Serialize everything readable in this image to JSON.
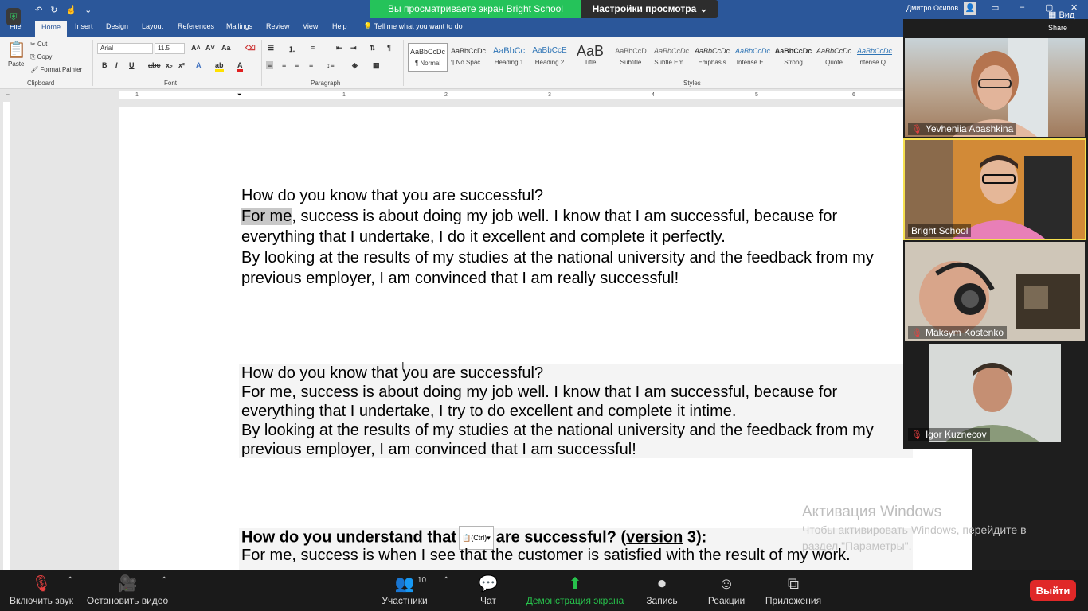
{
  "word": {
    "tabs": [
      "File",
      "Home",
      "Insert",
      "Design",
      "Layout",
      "References",
      "Mailings",
      "Review",
      "View",
      "Help"
    ],
    "tell_me": "Tell me what you want to do",
    "user_name": "Дмитро Осипов",
    "clipboard": {
      "paste": "Paste",
      "cut": "Cut",
      "copy": "Copy",
      "format_painter": "Format Painter",
      "label": "Clipboard"
    },
    "font": {
      "name": "Arial",
      "size": "11.5",
      "label": "Font"
    },
    "paragraph_label": "Paragraph",
    "styles_label": "Styles",
    "styles": [
      {
        "sample": "AaBbCcDc",
        "name": "¶ Normal"
      },
      {
        "sample": "AaBbCcDc",
        "name": "¶ No Spac..."
      },
      {
        "sample": "AaBbCc",
        "name": "Heading 1"
      },
      {
        "sample": "AaBbCcE",
        "name": "Heading 2"
      },
      {
        "sample": "AaB",
        "name": "Title"
      },
      {
        "sample": "AaBbCcD",
        "name": "Subtitle"
      },
      {
        "sample": "AaBbCcDc",
        "name": "Subtle Em..."
      },
      {
        "sample": "AaBbCcDc",
        "name": "Emphasis"
      },
      {
        "sample": "AaBbCcDc",
        "name": "Intense E..."
      },
      {
        "sample": "AaBbCcDc",
        "name": "Strong"
      },
      {
        "sample": "AaBbCcDc",
        "name": "Quote"
      },
      {
        "sample": "AaBbCcDc",
        "name": "Intense Q..."
      }
    ],
    "ruler_numbers": [
      "1",
      "1",
      "2",
      "3",
      "4",
      "5",
      "6"
    ]
  },
  "zoom": {
    "banner": "Вы просматриваете экран Bright School",
    "view_options": "Настройки просмотра",
    "view_label": "Вид",
    "share_label": "Share",
    "participants": [
      {
        "name": "Yevheniia Abashkina",
        "muted": true
      },
      {
        "name": "Bright School",
        "muted": false
      },
      {
        "name": "Maksym Kostenko",
        "muted": true
      },
      {
        "name": "Igor Kuznecov",
        "muted": true
      }
    ],
    "toolbar": {
      "unmute": "Включить звук",
      "stop_video": "Остановить видео",
      "participants": "Участники",
      "participants_count": "10",
      "chat": "Чат",
      "share_screen": "Демонстрация экрана",
      "record": "Запись",
      "reactions": "Реакции",
      "apps": "Приложения",
      "leave": "Выйти"
    }
  },
  "document": {
    "block1": {
      "q": "How do you know that you are successful?",
      "l1_hl": "For me",
      "l1_rest": ", success is about doing my job well. I know that I am successful, because for",
      "l2": "everything that I undertake, I do it excellent and complete it perfectly.",
      "l3": "By looking at the results of my studies at the national university and the feedback from my",
      "l4": "previous employer, I am convinced that I am really successful!"
    },
    "block2": {
      "q": "How do you know that you are successful?",
      "l1": "For me, success is about doing my job well. I know that I am successful, because for",
      "l2": "everything that I undertake, I try to do excellent and complete it intime.",
      "l3": "By looking at the results of my studies at the national university and the feedback from my",
      "l4": "previous employer, I am convinced that I am successful!"
    },
    "block3": {
      "heading_a": "How do you understand that",
      "paste_tag": "(Ctrl)",
      "heading_b": "are successful? (",
      "heading_version": "version",
      "heading_c": " 3):",
      "l1": "For me, success is when I see that the customer is satisfied with the result of my work."
    }
  },
  "watermark": {
    "title": "Активация Windows",
    "line1": "Чтобы активировать Windows, перейдите в",
    "line2": "раздел \"Параметры\"."
  }
}
